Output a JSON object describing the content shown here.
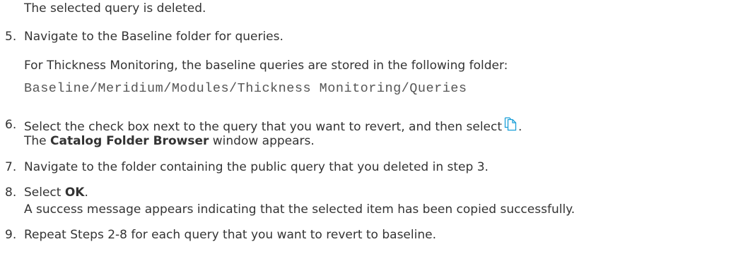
{
  "doc": {
    "result_deleted": "The selected query is deleted.",
    "steps": [
      {
        "num": "5.",
        "text": "Navigate to the Baseline folder for queries.",
        "note": "For Thickness Monitoring, the baseline queries are stored in the following folder:",
        "path": "Baseline/Meridium/Modules/Thickness Monitoring/Queries"
      },
      {
        "num": "6.",
        "text": "Select the check box next to the query that you want to revert, and then select",
        "icon": "copy-icon",
        "after_icon": ".",
        "result_bold": "Catalog Folder Browser",
        "result_rest": " window appears.",
        "result_prefix": "The "
      },
      {
        "num": "7.",
        "text": "Navigate to the folder containing the public query that you deleted in step 3."
      },
      {
        "num": "8.",
        "text_prefix": "Select ",
        "text_bold": "OK",
        "text_suffix": ".",
        "result": "A success message appears indicating that the selected item has been copied successfully."
      },
      {
        "num": "9.",
        "text": "Repeat Steps 2-8 for each query that you want to revert to baseline."
      }
    ]
  },
  "colors": {
    "text": "#333333",
    "mono": "#555555",
    "icon_accent": "#1a9fd8"
  }
}
